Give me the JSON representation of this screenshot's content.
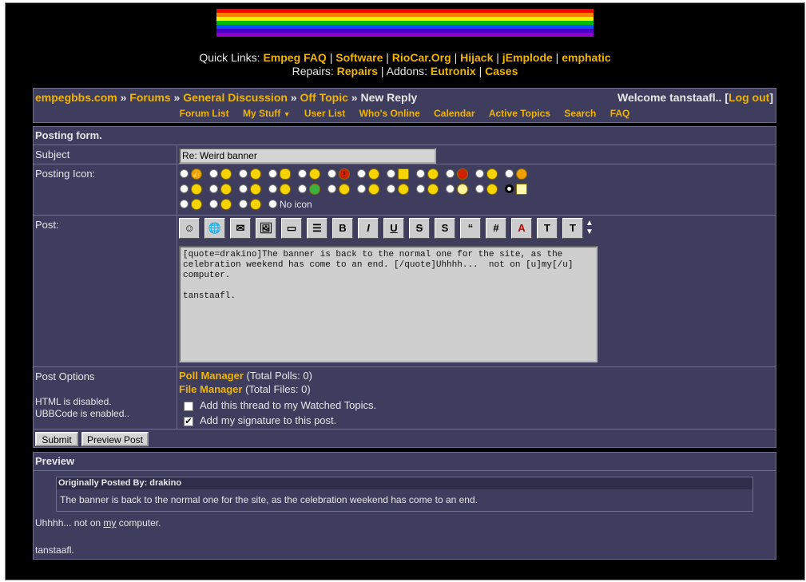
{
  "quicklinks": {
    "label": "Quick Links:",
    "links": [
      "Empeg FAQ",
      "Software",
      "RioCar.Org",
      "Hijack",
      "jEmplode",
      "emphatic"
    ],
    "repairs_label": "Repairs:",
    "repairs": "Repairs",
    "addons_label": "Addons:",
    "addons": [
      "Eutronix",
      "Cases"
    ]
  },
  "breadcrumb": {
    "items": [
      "empegbbs.com",
      "Forums",
      "General Discussion",
      "Off Topic"
    ],
    "current": "New Reply",
    "sep": "»"
  },
  "welcome": {
    "text": "Welcome tanstaafl..",
    "logout": "Log out"
  },
  "nav": [
    "Forum List",
    "My Stuff",
    "User List",
    "Who's Online",
    "Calendar",
    "Active Topics",
    "Search",
    "FAQ"
  ],
  "form": {
    "title": "Posting form.",
    "subject_label": "Subject",
    "subject_value": "Re: Weird banner",
    "icon_label": "Posting Icon:",
    "no_icon": "No icon",
    "post_label": "Post:",
    "post_text": "[quote=drakino]The banner is back to the normal one for the site, as the celebration weekend has come to an end. [/quote]Uhhhh...  not on [u]my[/u] computer.\n\ntanstaafl.",
    "options_label": "Post Options",
    "html_status": "HTML is disabled.",
    "ubb_status": "UBBCode is enabled..",
    "poll_manager": "Poll Manager",
    "poll_count": "(Total Polls: 0)",
    "file_manager": "File Manager",
    "file_count": "(Total Files: 0)",
    "watch_label": "Add this thread to my Watched Topics.",
    "sig_label": "Add my signature to this post.",
    "submit": "Submit",
    "preview": "Preview Post",
    "toolbar": [
      "☺",
      "🌐",
      "✉",
      "🖼",
      "▭",
      "☰",
      "B",
      "I",
      "U",
      "S",
      "S",
      "“",
      "#",
      "A",
      "T",
      "T"
    ]
  },
  "preview": {
    "title": "Preview",
    "quote_header": "Originally Posted By: drakino",
    "quote_body": "The banner is back to the normal one for the site, as the celebration weekend has come to an end.",
    "line1_pre": "Uhhhh... not on ",
    "line1_u": "my",
    "line1_post": " computer.",
    "sig": "tanstaafl."
  },
  "colors": {
    "accent": "#f0b400",
    "panel": "#3e3d5e",
    "background": "#000000"
  }
}
